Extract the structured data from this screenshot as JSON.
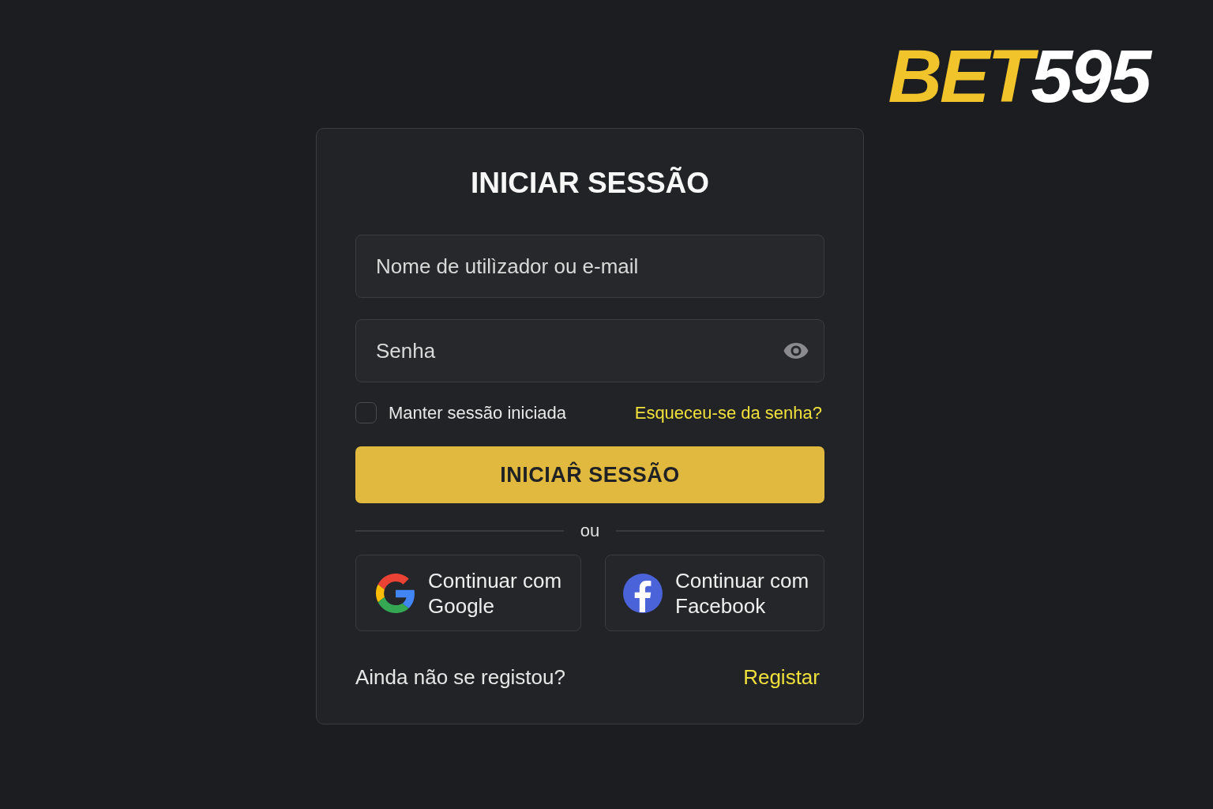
{
  "logo": {
    "parts": [
      {
        "text": "BET",
        "color": "#f2c42c"
      },
      {
        "text": "595",
        "color": "#ffffff"
      }
    ]
  },
  "login_card": {
    "title": "INICIAR SESSÃO",
    "fields": [
      {
        "kind": "text",
        "placeholder": "Nome de utilìzador ou e-mail"
      },
      {
        "kind": "password",
        "placeholder": "Senha"
      }
    ],
    "remember": {
      "label": "Manter sessão iniciada",
      "checked": false
    },
    "forgot_link": "Esqueceu-se da senha?",
    "submit_button": "INICIAR̂ SESSÃO",
    "divider": "ou",
    "social_buttons": [
      {
        "kind": "google",
        "label": "Continuar com Google"
      },
      {
        "kind": "facebook",
        "label": "Continuar com Facebook"
      }
    ],
    "signup_prompt": "Ainda não se registou?",
    "signup_link": "Registar"
  }
}
